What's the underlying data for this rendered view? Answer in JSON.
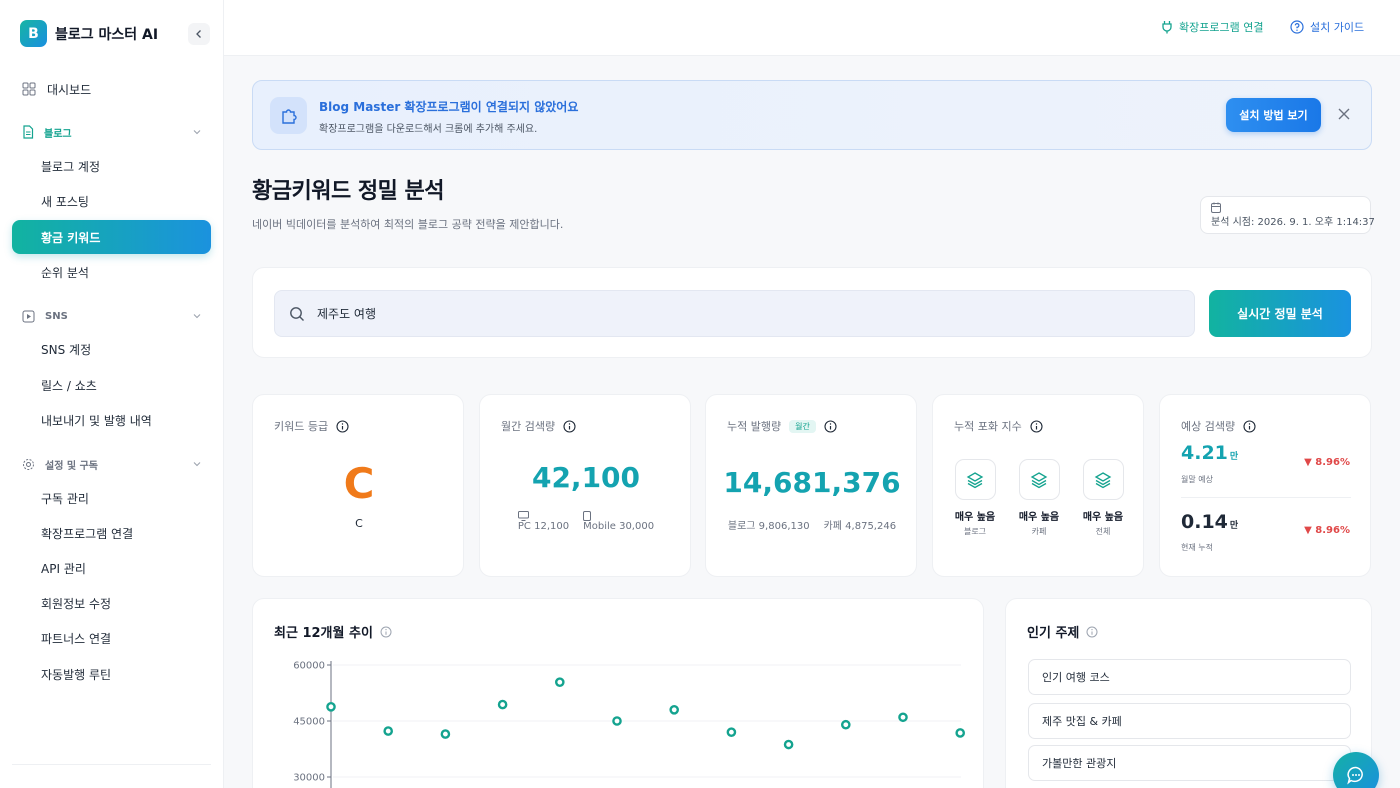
{
  "app": {
    "logo_letter": "B",
    "name": "블로그 마스터 AI"
  },
  "sidebar": {
    "dashboard": "대시보드",
    "sections": [
      {
        "label": "블로그",
        "items": [
          "블로그 계정",
          "새 포스팅",
          "황금 키워드",
          "순위 분석"
        ]
      },
      {
        "label": "SNS",
        "items": [
          "SNS 계정",
          "릴스 / 쇼츠",
          "내보내기 및 발행 내역"
        ]
      },
      {
        "label": "설정 및 구독",
        "items": [
          "구독 관리",
          "확장프로그램 연결",
          "API 관리",
          "회원정보 수정",
          "파트너스 연결",
          "자동발행 루틴"
        ]
      }
    ],
    "active_item": "황금 키워드"
  },
  "topbar": {
    "extension_link": "확장프로그램 연결",
    "guide_link": "설치 가이드"
  },
  "banner": {
    "title": "Blog Master 확장프로그램이 연결되지 않았어요",
    "desc": "확장프로그램을 다운로드해서 크롬에 추가해 주세요.",
    "button": "설치 방법 보기"
  },
  "page": {
    "title": "황금키워드 정밀 분석",
    "subtitle": "네이버 빅데이터를 분석하여 최적의 블로그 공략 전략을 제안합니다.",
    "analysis_time": "분석 시점: 2026. 9. 1. 오후 1:14:37"
  },
  "search": {
    "value": "제주도 여행",
    "button": "실시간 정밀 분석"
  },
  "stats": {
    "grade": {
      "label": "키워드 등급",
      "big": "C",
      "small": "C"
    },
    "monthly": {
      "label": "월간 검색량",
      "value": "42,100",
      "pc": "PC 12,100",
      "mobile": "Mobile 30,000"
    },
    "published": {
      "label": "누적 발행량",
      "badge": "월간",
      "value": "14,681,376",
      "blog": "블로그 9,806,130",
      "cafe": "카페 4,875,246"
    },
    "saturation": {
      "label": "누적 포화 지수",
      "items": [
        {
          "level": "매우 높음",
          "label": "블로그"
        },
        {
          "level": "매우 높음",
          "label": "카페"
        },
        {
          "level": "매우 높음",
          "label": "전체"
        }
      ]
    },
    "predict": {
      "label": "예상 검색량",
      "monthly": {
        "value": "4.21",
        "unit": "만",
        "label": "월말 예상",
        "change": "8.96%"
      },
      "current": {
        "value": "0.14",
        "unit": "만",
        "label": "현재 누적",
        "change": "8.96%"
      }
    }
  },
  "trend": {
    "title": "최근 12개월 추이"
  },
  "chart_data": {
    "type": "scatter",
    "title": "",
    "y_ticks": [
      "60000",
      "45000",
      "30000"
    ],
    "ylim": [
      0,
      60000
    ],
    "values": [
      48800,
      42300,
      41500,
      49400,
      55400,
      45000,
      48000,
      42000,
      38700,
      44000,
      46000,
      41800
    ],
    "grid": true
  },
  "popular": {
    "title": "인기 주제",
    "items": [
      "인기 여행 코스",
      "제주 맛집 & 카페",
      "가볼만한 관광지"
    ]
  },
  "colors": {
    "accent": "#14a38f",
    "primary_blue": "#2a6fdb",
    "grade_orange": "#f07a1a",
    "negative": "#e04848"
  }
}
